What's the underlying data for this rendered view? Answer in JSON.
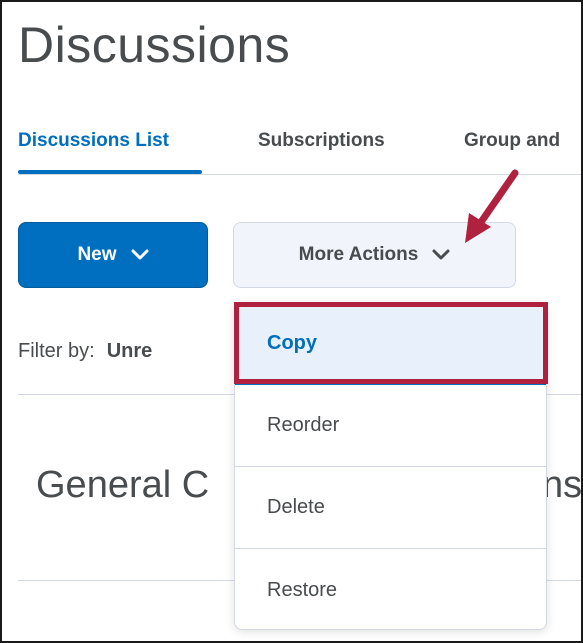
{
  "page": {
    "title": "Discussions"
  },
  "tabs": [
    {
      "label": "Discussions List",
      "active": true
    },
    {
      "label": "Subscriptions",
      "active": false
    },
    {
      "label": "Group and",
      "active": false
    }
  ],
  "toolbar": {
    "new_label": "New",
    "more_actions_label": "More Actions"
  },
  "filter": {
    "label": "Filter by:",
    "value": "Unre"
  },
  "section": {
    "heading_start": "General C",
    "heading_end": "ns"
  },
  "more_actions_menu": {
    "items": [
      {
        "label": "Copy",
        "highlighted": true
      },
      {
        "label": "Reorder"
      },
      {
        "label": "Delete"
      },
      {
        "label": "Restore"
      }
    ]
  },
  "colors": {
    "primary": "#006fbf",
    "text": "#494c4e",
    "annotation": "#b0203f",
    "button_secondary": "#f1f5fb",
    "divider": "#d3d9e3"
  },
  "icons": {
    "new_dropdown": "chevron-down-icon",
    "more_actions_dropdown": "chevron-down-icon",
    "annotation_arrow": "arrow-icon"
  }
}
